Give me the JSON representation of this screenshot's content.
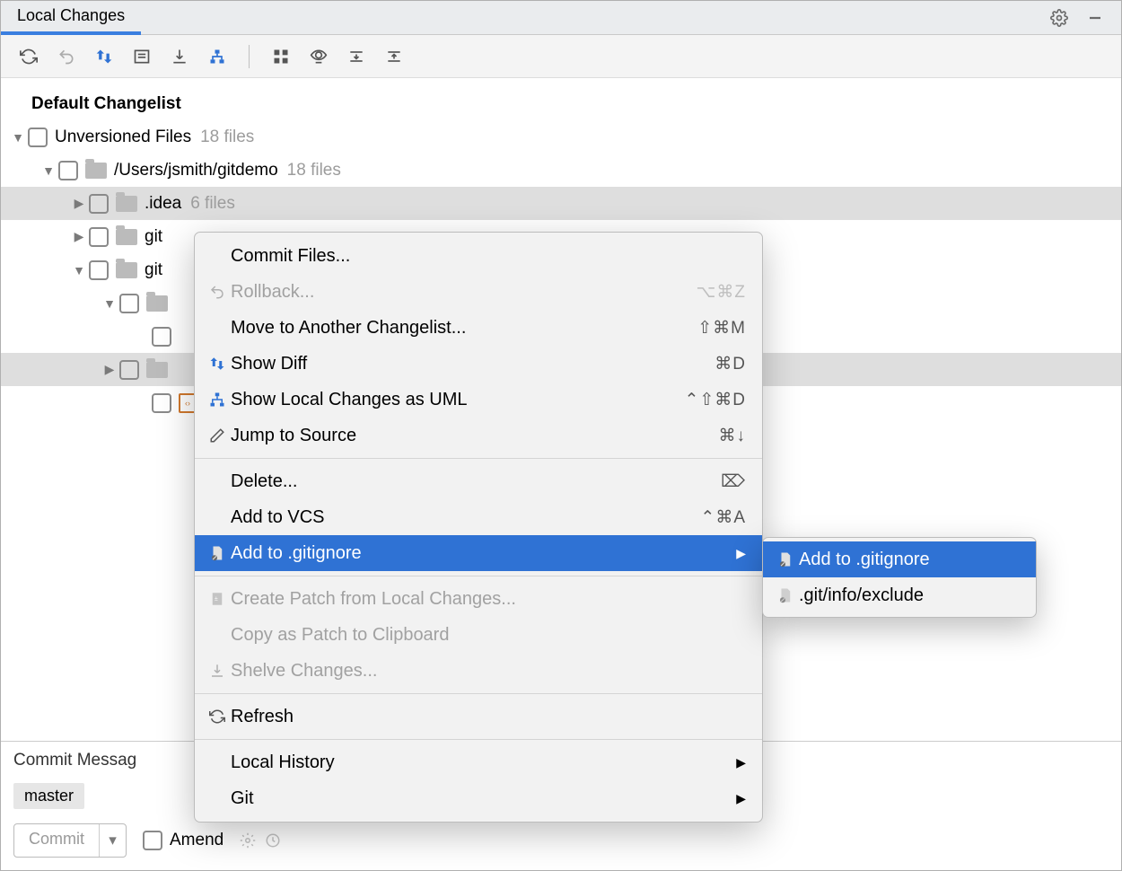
{
  "header": {
    "tab": "Local Changes"
  },
  "tree": {
    "default_changelist": "Default Changelist",
    "unversioned": {
      "label": "Unversioned Files",
      "count": "18 files"
    },
    "path_root": {
      "label": "/Users/jsmith/gitdemo",
      "count": "18 files"
    },
    "idea": {
      "label": ".idea",
      "count": "6 files"
    },
    "git_a": {
      "label": "git"
    },
    "git_b": {
      "label": "git"
    }
  },
  "context_menu": {
    "commit_files": "Commit Files...",
    "rollback": {
      "label": "Rollback...",
      "accel": "⌥⌘Z"
    },
    "move_changelist": {
      "label": "Move to Another Changelist...",
      "accel": "⇧⌘M"
    },
    "show_diff": {
      "label": "Show Diff",
      "accel": "⌘D"
    },
    "show_uml": {
      "label": "Show Local Changes as UML",
      "accel": "⌃⇧⌘D"
    },
    "jump_source": {
      "label": "Jump to Source",
      "accel": "⌘↓"
    },
    "delete": {
      "label": "Delete...",
      "accel": "⌦"
    },
    "add_vcs": {
      "label": "Add to VCS",
      "accel": "⌃⌘A"
    },
    "add_gitignore": "Add to .gitignore",
    "create_patch": "Create Patch from Local Changes...",
    "copy_patch": "Copy as Patch to Clipboard",
    "shelve": "Shelve Changes...",
    "refresh": "Refresh",
    "local_history": "Local History",
    "git": "Git"
  },
  "submenu": {
    "add_gitignore": "Add to .gitignore",
    "git_info_exclude": ".git/info/exclude"
  },
  "commit": {
    "message_label": "Commit Messag",
    "branch": "master",
    "button": "Commit",
    "amend": "Amend"
  }
}
